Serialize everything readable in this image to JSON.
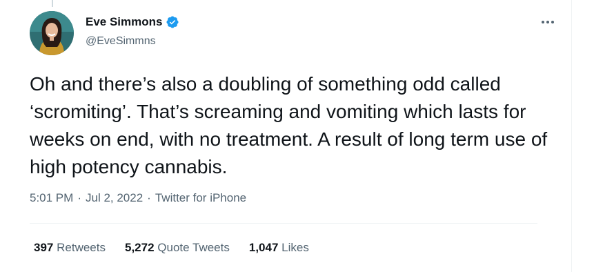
{
  "author": {
    "display_name": "Eve Simmons",
    "handle": "@EveSimmns",
    "verified_icon": "verified-badge-icon"
  },
  "tweet": {
    "text": "Oh and there’s also a doubling of something odd called ‘scromiting’. That’s screaming and vomiting which lasts for weeks on end, with no treatment. A result of long term use of high potency cannabis.",
    "time": "5:01 PM",
    "separator": "·",
    "date": "Jul 2, 2022",
    "source": "Twitter for iPhone"
  },
  "stats": {
    "retweets_count": "397",
    "retweets_label": "Retweets",
    "quotes_count": "5,272",
    "quotes_label": "Quote Tweets",
    "likes_count": "1,047",
    "likes_label": "Likes"
  },
  "colors": {
    "text_primary": "#0f1419",
    "text_secondary": "#536471",
    "verified_blue": "#1d9bf0",
    "divider": "#eff3f4"
  }
}
